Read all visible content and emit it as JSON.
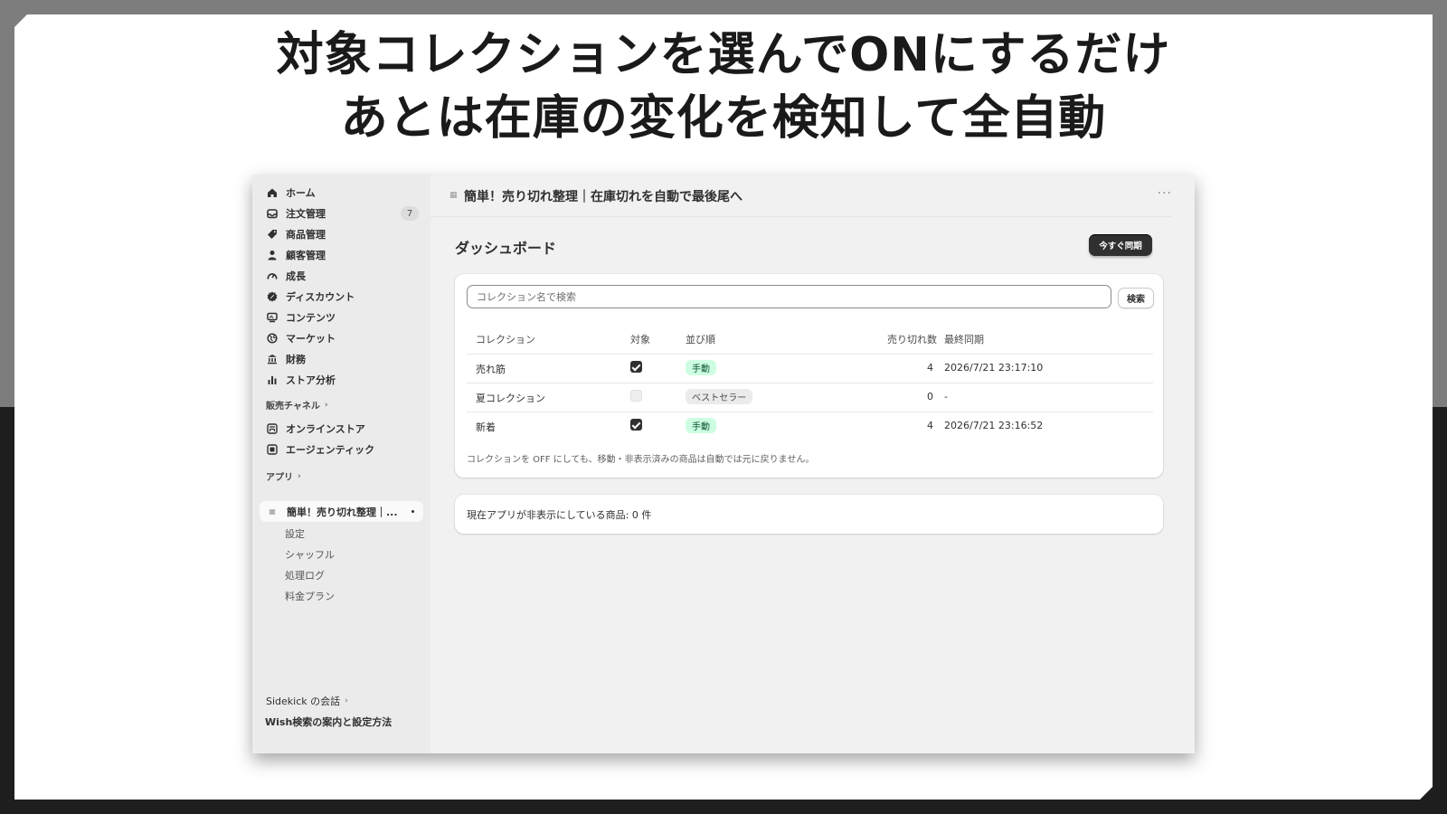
{
  "headline": {
    "line1": "対象コレクションを選んでONにするだけ",
    "line2": "あとは在庫の変化を検知して全自動"
  },
  "sidebar": {
    "items": [
      {
        "label": "ホーム",
        "icon": "home-icon"
      },
      {
        "label": "注文管理",
        "icon": "inbox-icon",
        "badge": "7"
      },
      {
        "label": "商品管理",
        "icon": "tag-icon"
      },
      {
        "label": "顧客管理",
        "icon": "person-icon"
      },
      {
        "label": "成長",
        "icon": "gauge-icon"
      },
      {
        "label": "ディスカウント",
        "icon": "discount-icon"
      },
      {
        "label": "コンテンツ",
        "icon": "content-icon"
      },
      {
        "label": "マーケット",
        "icon": "globe-icon"
      },
      {
        "label": "財務",
        "icon": "bank-icon"
      },
      {
        "label": "ストア分析",
        "icon": "bar-chart-icon"
      }
    ],
    "sales_channels_label": "販売チャネル",
    "channels": [
      {
        "label": "オンラインストア",
        "icon": "store-icon"
      },
      {
        "label": "エージェンティック",
        "icon": "agentic-icon"
      }
    ],
    "apps_label": "アプリ",
    "active_app_label": "簡単！売り切れ整理｜...",
    "app_sub_items": [
      "設定",
      "シャッフル",
      "処理ログ",
      "料金プラン"
    ],
    "sidekick_label": "Sidekick の会話",
    "wish_label": "Wish検索の案内と設定方法"
  },
  "topbar": {
    "title": "簡単！売り切れ整理｜在庫切れを自動で最後尾へ",
    "more": "···"
  },
  "page": {
    "title": "ダッシュボード",
    "sync_button": "今すぐ同期"
  },
  "search": {
    "placeholder": "コレクション名で検索",
    "button": "検索"
  },
  "table": {
    "headers": [
      "コレクション",
      "対象",
      "並び順",
      "売り切れ数",
      "最終同期"
    ],
    "rows": [
      {
        "collection": "売れ筋",
        "enabled": true,
        "sort": "手動",
        "sold_out": "4",
        "last_sync": "2026/7/21 23:17:10"
      },
      {
        "collection": "夏コレクション",
        "enabled": false,
        "sort": "ベストセラー",
        "sold_out": "0",
        "last_sync": "-"
      },
      {
        "collection": "新着",
        "enabled": true,
        "sort": "手動",
        "sold_out": "4",
        "last_sync": "2026/7/21 23:16:52"
      }
    ],
    "note": "コレクションを OFF にしても、移動・非表示済みの商品は自動では元に戻りません。"
  },
  "hidden_products": {
    "text": "現在アプリが非表示にしている商品: 0 件"
  },
  "colors": {
    "accent_dark": "#303030",
    "tag_green_bg": "#cdfee1",
    "tag_green_text": "#0c5132",
    "tag_gray_bg": "#ebebeb"
  }
}
